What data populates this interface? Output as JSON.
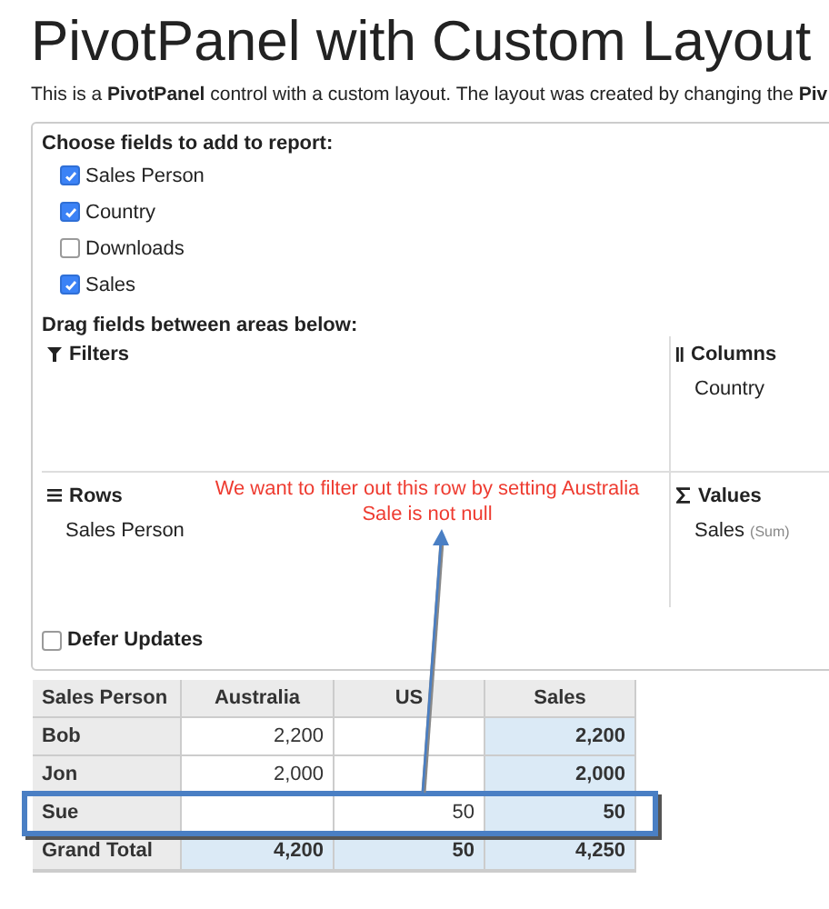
{
  "title": "PivotPanel with Custom Layout",
  "description": "This is a **PivotPanel** control with a custom layout. The layout was created by changing the **Piv**",
  "field_chooser": {
    "heading": "Choose fields to add to report:",
    "fields": [
      {
        "label": "Sales Person",
        "checked": true
      },
      {
        "label": "Country",
        "checked": true
      },
      {
        "label": "Downloads",
        "checked": false
      },
      {
        "label": "Sales",
        "checked": true
      }
    ]
  },
  "areas": {
    "heading": "Drag fields between areas below:",
    "filters": {
      "label": "Filters"
    },
    "columns": {
      "label": "Columns",
      "items": [
        {
          "field": "Country"
        }
      ]
    },
    "rows": {
      "label": "Rows",
      "items": [
        {
          "field": "Sales Person"
        }
      ]
    },
    "values": {
      "label": "Values",
      "items": [
        {
          "field": "Sales",
          "aggregate": "(Sum)"
        }
      ]
    }
  },
  "defer_updates": {
    "label": "Defer Updates",
    "checked": false
  },
  "annotation": {
    "text": "We want to filter out this row by setting Australia Sale is not null"
  },
  "table": {
    "columns": [
      "Sales Person",
      "Australia",
      "US",
      "Sales"
    ],
    "rows": [
      {
        "kind": "data",
        "highlighted": false,
        "cells": [
          "Bob",
          "2,200",
          null,
          "2,200"
        ]
      },
      {
        "kind": "data",
        "highlighted": false,
        "cells": [
          "Jon",
          "2,000",
          null,
          "2,000"
        ]
      },
      {
        "kind": "data",
        "highlighted": true,
        "cells": [
          "Sue",
          null,
          "50",
          "50"
        ]
      },
      {
        "kind": "total",
        "highlighted": false,
        "cells": [
          "Grand Total",
          "4,200",
          "50",
          "4,250"
        ]
      }
    ]
  }
}
